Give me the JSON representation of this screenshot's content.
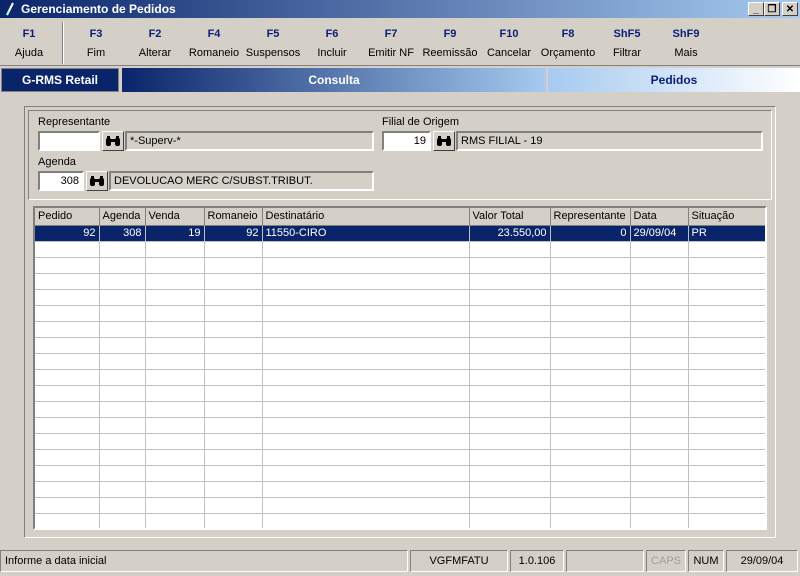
{
  "window": {
    "title": "Gerenciamento de Pedidos"
  },
  "toolbar": {
    "buttons": [
      {
        "key": "F1",
        "label": "Ajuda"
      },
      {
        "key": "F3",
        "label": "Fim"
      },
      {
        "key": "F2",
        "label": "Alterar"
      },
      {
        "key": "F4",
        "label": "Romaneio"
      },
      {
        "key": "F5",
        "label": "Suspensos"
      },
      {
        "key": "F6",
        "label": "Incluir"
      },
      {
        "key": "F7",
        "label": "Emitir NF"
      },
      {
        "key": "F9",
        "label": "Reemissão"
      },
      {
        "key": "F10",
        "label": "Cancelar"
      },
      {
        "key": "F8",
        "label": "Orçamento"
      },
      {
        "key": "ShF5",
        "label": "Filtrar"
      },
      {
        "key": "ShF9",
        "label": "Mais"
      }
    ]
  },
  "brand": {
    "name": "G-RMS Retail",
    "module": "Consulta",
    "section": "Pedidos"
  },
  "filter": {
    "representante_label": "Representante",
    "representante_code": "",
    "representante_desc": "*-Superv-*",
    "filial_label": "Filial de Origem",
    "filial_code": "19",
    "filial_desc": "RMS FILIAL - 19",
    "agenda_label": "Agenda",
    "agenda_code": "308",
    "agenda_desc": "DEVOLUCAO MERC C/SUBST.TRIBUT."
  },
  "grid": {
    "columns": [
      "Pedido",
      "Agenda",
      "Venda",
      "Romaneio",
      "Destinatário",
      "Valor Total",
      "Representante",
      "Data",
      "Situação"
    ],
    "rows": [
      [
        "92",
        "308",
        "19",
        "92",
        "11550-CIRO",
        "23.550,00",
        "0",
        "29/09/04",
        "PR"
      ]
    ]
  },
  "status": {
    "message": "Informe a data inicial",
    "program": "VGFMFATU",
    "version": "1.0.106",
    "caps": "CAPS",
    "num": "NUM",
    "date": "29/09/04"
  },
  "colors": {
    "title_start": "#0a246a",
    "title_end": "#a6caf0",
    "selection": "#0a246a",
    "key_text": "#0a1e78"
  }
}
